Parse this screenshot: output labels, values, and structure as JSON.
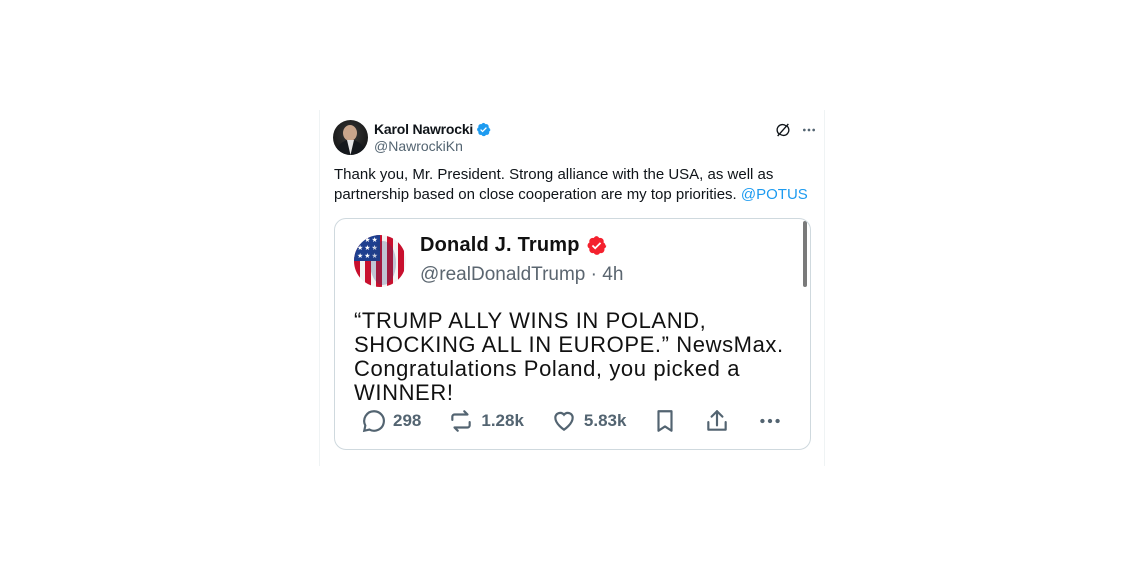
{
  "author": {
    "name": "Karol Nawrocki",
    "handle": "@NawrockiKn",
    "verified_color": "#1d9bf0"
  },
  "post": {
    "text": "Thank you, Mr. President. Strong alliance with the USA, as well as partnership based on close cooperation are my top priorities.",
    "mention": "@POTUS"
  },
  "top_icons": [
    "grok-icon",
    "more-icon"
  ],
  "quoted": {
    "name": "Donald J. Trump",
    "handle": "@realDonaldTrump",
    "separator": "·",
    "time": "4h",
    "verified_color": "#f4212e",
    "text": "“TRUMP ALLY WINS IN POLAND, SHOCKING ALL IN EUROPE.” NewsMax. Congratulations Poland, you picked a WINNER!",
    "actions": {
      "replies": "298",
      "reposts": "1.28k",
      "likes": "5.83k"
    }
  },
  "colors": {
    "text": "#0f1419",
    "secondary": "#536471",
    "link": "#1d9bf0",
    "border": "#cfd9de"
  }
}
